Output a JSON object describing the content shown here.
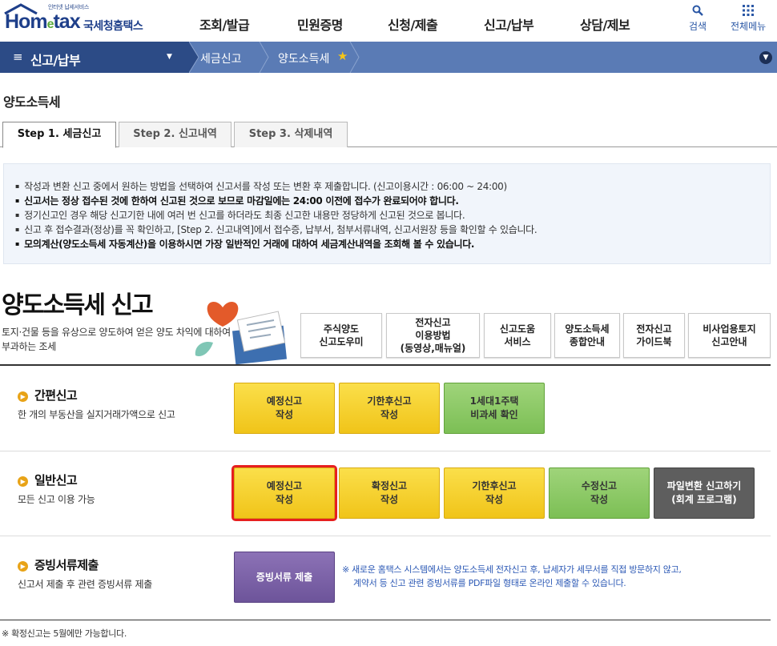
{
  "header": {
    "logo_sub": "인터넷 납세서비스",
    "logo_main": "Hom",
    "logo_e": "e",
    "logo_main2": "tax",
    "logo_kor": "국세청홈택스",
    "gnb": [
      "조회/발급",
      "민원증명",
      "신청/제출",
      "신고/납부",
      "상담/제보"
    ],
    "search_label": "검색",
    "allmenu_label": "전체메뉴"
  },
  "breadcrumb": {
    "menu": "신고/납부",
    "item1": "세금신고",
    "item2": "양도소득세"
  },
  "page_title": "양도소득세",
  "tabs": [
    "Step 1. 세금신고",
    "Step 2. 신고내역",
    "Step 3. 삭제내역"
  ],
  "notice": [
    "작성과 변환 신고 중에서 원하는 방법을 선택하여 신고서를 작성 또는 변환 후 제출합니다. (신고이용시간 : 06:00 ~ 24:00)",
    "신고서는 정상 접수된 것에 한하여 신고된 것으로 보므로 마감일에는 24:00 이전에 접수가 완료되어야 합니다.",
    "정기신고인 경우 해당 신고기한 내에 여러 번 신고를 하더라도 최종 신고한 내용만 정당하게 신고된 것으로 봅니다.",
    "신고 후 접수결과(정상)를 꼭 확인하고, [Step 2. 신고내역]에서 접수증, 납부서, 첨부서류내역, 신고서원장 등을 확인할 수 있습니다.",
    "모의계산(양도소득세 자동계산)을 이용하시면 가장 일반적인 거래에 대하여 세금계산내역을 조회해 볼 수 있습니다."
  ],
  "section": {
    "title": "양도소득세 신고",
    "desc": "토지·건물 등을 유상으로 양도하여 얻은 양도 차익에 대하여 부과하는 조세"
  },
  "links": [
    "주식양도\n신고도우미",
    "전자신고\n이용방법\n(동영상,매뉴얼)",
    "신고도움\n서비스",
    "양도소득세\n종합안내",
    "전자신고\n가이드북",
    "비사업용토지\n신고안내"
  ],
  "simple": {
    "title": "간편신고",
    "desc": "한 개의 부동산을 실지거래가액으로 신고",
    "buttons": [
      "예정신고\n작성",
      "기한후신고\n작성",
      "1세대1주택\n비과세 확인"
    ]
  },
  "general": {
    "title": "일반신고",
    "desc": "모든 신고 이용 가능",
    "buttons": [
      "예정신고\n작성",
      "확정신고\n작성",
      "기한후신고\n작성",
      "수정신고\n작성",
      "파일변환 신고하기\n(회계 프로그램)"
    ]
  },
  "evidence": {
    "title": "증빙서류제출",
    "desc": "신고서 제출 후 관련 증빙서류 제출",
    "button": "증빙서류 제출",
    "note1": "※ 새로운 홈택스 시스템에서는 양도소득세 전자신고 후, 납세자가 세무서를 직접 방문하지 않고,",
    "note2": "계약서 등 신고 관련 증빙서류를 PDF파일 형태로 온라인 제출할 수 있습니다."
  },
  "footnote": "※ 확정신고는 5월에만 가능합니다.",
  "colors": {
    "brand": "#1e3f8a",
    "bar_dark": "#2c4b86",
    "bar": "#5a7bb5",
    "yellow": "#f0c419",
    "green": "#7cbf55",
    "highlight": "#e61f1f"
  },
  "icons": {
    "search": "search-icon",
    "allmenu": "grid-icon",
    "star": "star-icon"
  }
}
